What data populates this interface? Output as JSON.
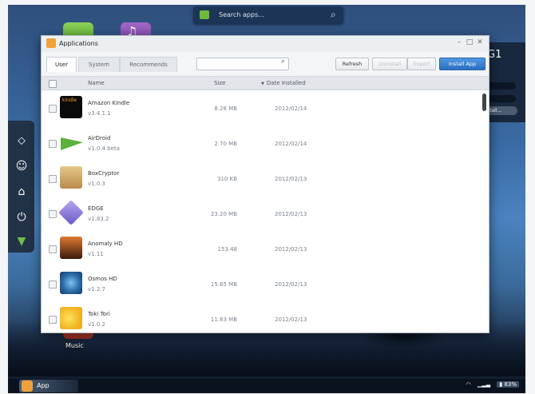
{
  "search_bar": {
    "placeholder": "Search apps..."
  },
  "right_widget": {
    "title": "G1",
    "button": "stall..."
  },
  "dock": {
    "items": [
      {
        "name": "messages-icon",
        "glyph": "⬦"
      },
      {
        "name": "add-contact-icon",
        "glyph": "☺"
      },
      {
        "name": "home-icon",
        "glyph": "⌂"
      },
      {
        "name": "power-icon",
        "glyph": "⏻"
      },
      {
        "name": "airdroid-logo-icon",
        "glyph": "▼"
      }
    ]
  },
  "desktop": {
    "music_label": "Music"
  },
  "window": {
    "title": "Applications",
    "controls": {
      "minimize": "–",
      "maximize": "□",
      "close": "✕"
    },
    "tabs": [
      {
        "label": "User",
        "active": true
      },
      {
        "label": "System",
        "active": false
      },
      {
        "label": "Recommends",
        "active": false
      }
    ],
    "search_value": "",
    "buttons": {
      "refresh": "Refresh",
      "uninstall": "Uninstall",
      "export": "Export",
      "install": "Install App"
    },
    "columns": {
      "name": "Name",
      "size": "Size",
      "date": "Date Installed"
    },
    "apps": [
      {
        "name": "Amazon Kindle",
        "version": "v3.4.1.1",
        "size": "8.28 MB",
        "date": "2012/02/14",
        "icon": "kindle-icon",
        "icon_text": "kindle"
      },
      {
        "name": "AirDroid",
        "version": "v1.0.4 beta",
        "size": "2.70 MB",
        "date": "2012/02/14",
        "icon": "airdroid-icon"
      },
      {
        "name": "BoxCryptor",
        "version": "v1.0.3",
        "size": "310 KB",
        "date": "2012/02/13",
        "icon": "boxcryptor-icon"
      },
      {
        "name": "EDGE",
        "version": "v1.83.2",
        "size": "23.20 MB",
        "date": "2012/02/13",
        "icon": "edge-icon"
      },
      {
        "name": "Anomaly HD",
        "version": "v1.11",
        "size": "153.48",
        "date": "2012/02/13",
        "icon": "anomaly-icon"
      },
      {
        "name": "Osmos HD",
        "version": "v1.2.7",
        "size": "15.65 MB",
        "date": "2012/02/13",
        "icon": "osmos-icon"
      },
      {
        "name": "Toki Tori",
        "version": "v1.0.2",
        "size": "11.83 MB",
        "date": "2012/02/13",
        "icon": "toki-tori-icon"
      }
    ]
  },
  "taskbar": {
    "app_label": "App",
    "battery": "83%"
  }
}
